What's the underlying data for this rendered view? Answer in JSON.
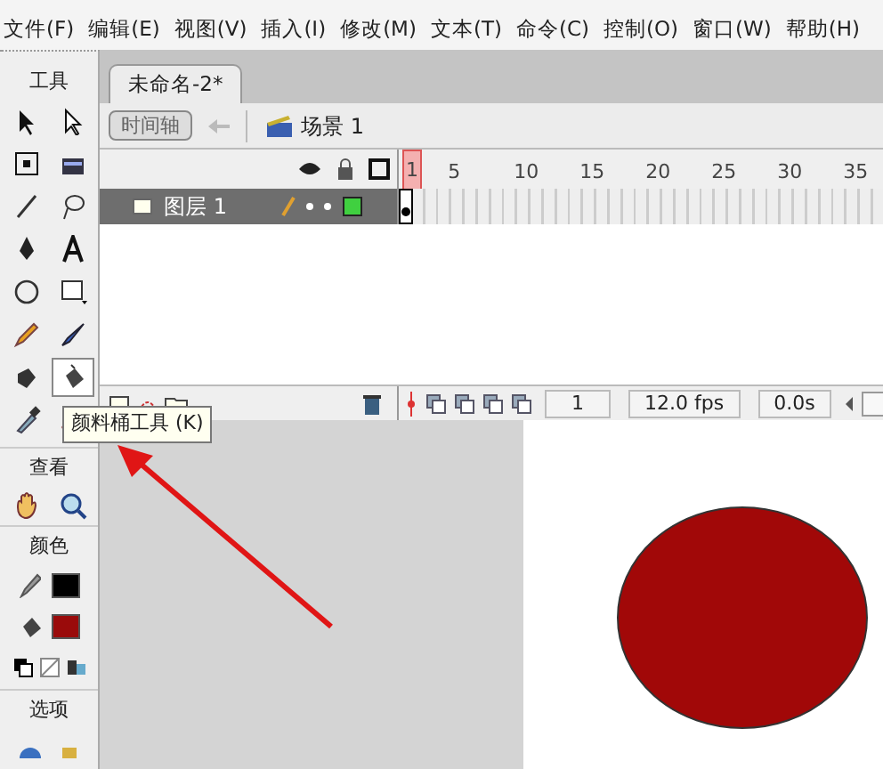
{
  "menu": [
    "文件(F)",
    "编辑(E)",
    "视图(V)",
    "插入(I)",
    "修改(M)",
    "文本(T)",
    "命令(C)",
    "控制(O)",
    "窗口(W)",
    "帮助(H)"
  ],
  "toolbox": {
    "title": "工具",
    "tools": [
      {
        "selected": false
      },
      {
        "selected": false
      },
      {
        "selected": false
      },
      {
        "selected": false
      },
      {
        "selected": false
      },
      {
        "selected": false
      },
      {
        "selected": false
      },
      {
        "selected": false
      },
      {
        "selected": false
      },
      {
        "selected": false
      },
      {
        "selected": false
      },
      {
        "selected": false
      },
      {
        "selected": false
      },
      {
        "selected": true
      },
      {
        "selected": false
      },
      {
        "selected": false
      }
    ],
    "view_title": "查看",
    "colors_title": "颜色",
    "swatches": [
      {
        "kind": "stroke",
        "color": "#000000"
      },
      {
        "kind": "fill",
        "color": "#9a0b0b"
      }
    ],
    "options_title": "选项",
    "tooltip": "颜料桶工具 (K)"
  },
  "document_tab": {
    "label": "未命名-2*",
    "selected": true
  },
  "edit_bar": {
    "timeline_button": "时间轴",
    "scene": "场景 1"
  },
  "timeline": {
    "ruler": [
      "1",
      "5",
      "10",
      "15",
      "20",
      "25",
      "30",
      "35"
    ],
    "layers": [
      {
        "name": "图层 1",
        "selected": true
      }
    ],
    "current_frame": "1",
    "frame_rate": "12.0 fps",
    "elapsed": "0.0s"
  }
}
